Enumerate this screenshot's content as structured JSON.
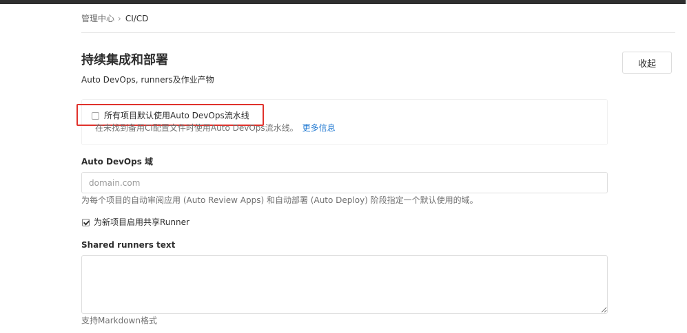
{
  "breadcrumb": {
    "parent": "管理中心",
    "separator": "›",
    "current": "CI/CD"
  },
  "section": {
    "title": "持续集成和部署",
    "description": "Auto DevOps, runners及作业产物",
    "collapse_label": "收起"
  },
  "auto_devops": {
    "checkbox_label": "所有项目默认使用Auto DevOps流水线",
    "checked": false,
    "help_text": "在未找到备用CI配置文件时使用Auto DevOps流水线。",
    "more_info_link": "更多信息"
  },
  "domain": {
    "label": "Auto DevOps 域",
    "value": "",
    "placeholder": "domain.com",
    "help_text": "为每个项目的自动审阅应用 (Auto Review Apps) 和自动部署 (Auto Deploy) 阶段指定一个默认使用的域。"
  },
  "shared_runners": {
    "checkbox_label": "为新项目启用共享Runner",
    "checked": true
  },
  "runners_text": {
    "label": "Shared runners text",
    "value": "",
    "help_text": "支持Markdown格式"
  },
  "colors": {
    "highlight": "#e0312b",
    "link": "#1f78d1",
    "top_bar": "#2f2f2f"
  }
}
